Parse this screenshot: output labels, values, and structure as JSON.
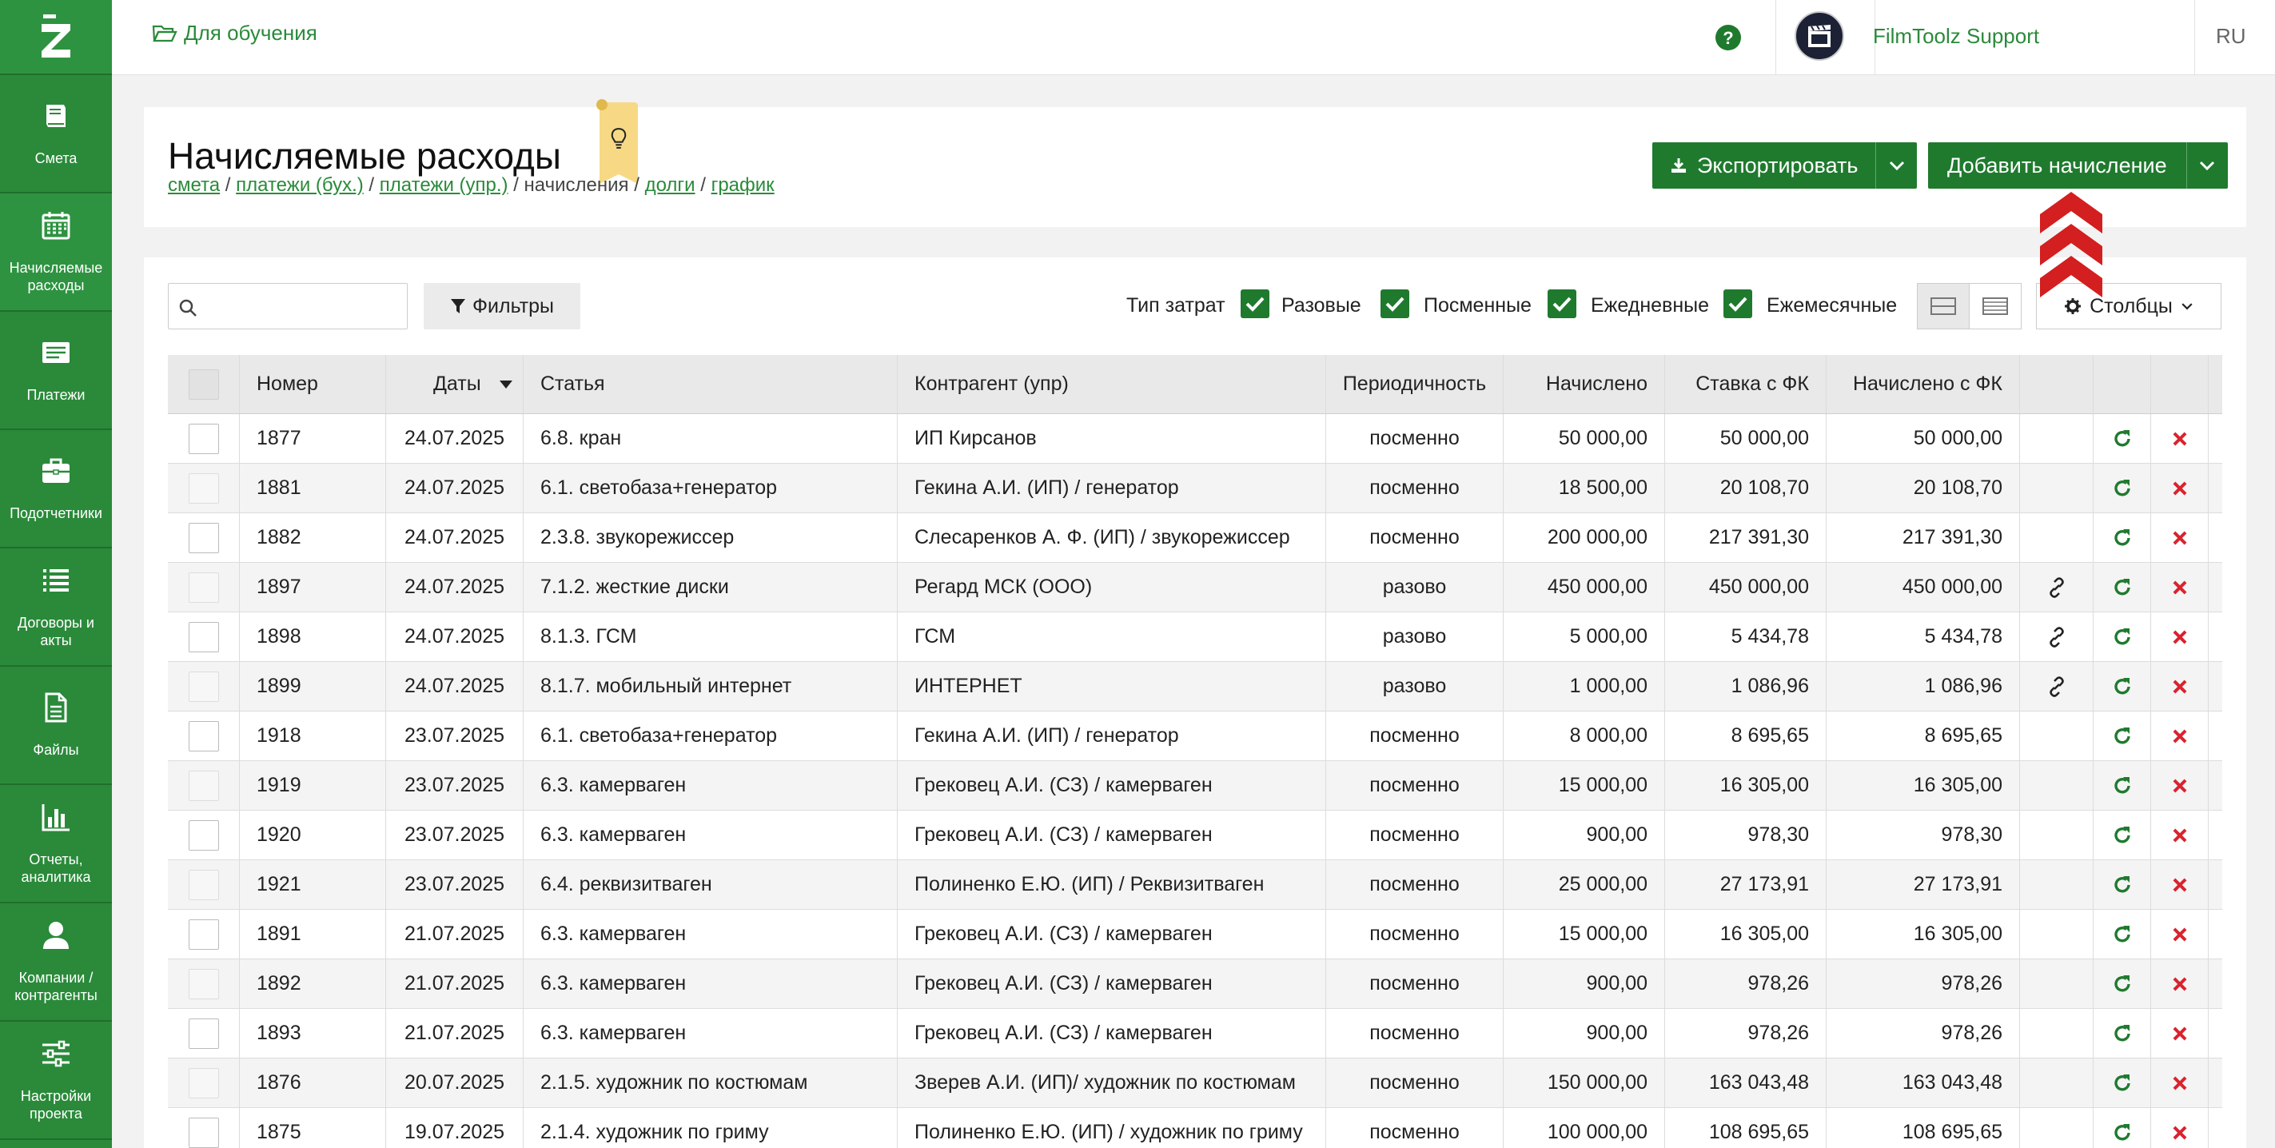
{
  "app": {
    "logo": "Z"
  },
  "sidebar": {
    "items": [
      {
        "label": "Смета",
        "icon": "book-icon"
      },
      {
        "label": "Начисляемые\nрасходы",
        "icon": "calendar-icon"
      },
      {
        "label": "Платежи",
        "icon": "list-card-icon"
      },
      {
        "label": "Подотчетники",
        "icon": "briefcase-icon"
      },
      {
        "label": "Договоры и\nакты",
        "icon": "list-icon"
      },
      {
        "label": "Файлы",
        "icon": "file-icon"
      },
      {
        "label": "Отчеты,\nаналитика",
        "icon": "bar-chart-icon"
      },
      {
        "label": "Компании /\nконтрагенты",
        "icon": "user-icon"
      },
      {
        "label": "Настройки\nпроекта",
        "icon": "sliders-icon"
      }
    ]
  },
  "topbar": {
    "project": "Для обучения",
    "user_name": "FilmToolz Support",
    "lang": "RU"
  },
  "header": {
    "title": "Начисляемые расходы",
    "breadcrumbs": [
      "смета",
      "платежи (бух.)",
      "платежи (упр.)",
      "начисления",
      "долги",
      "график"
    ],
    "export_label": "Экспортировать",
    "add_label": "Добавить начисление"
  },
  "toolbar": {
    "search_placeholder": "",
    "filters_label": "Фильтры",
    "cost_type_label": "Тип затрат",
    "cost_types": [
      "Разовые",
      "Посменные",
      "Ежедневные",
      "Ежемесячные"
    ],
    "columns_label": "Столбцы"
  },
  "table": {
    "headers": [
      "Номер",
      "Даты",
      "Статья",
      "Контрагент (упр)",
      "Периодичность",
      "Начислено",
      "Ставка с ФК",
      "Начислено с ФК"
    ],
    "rows": [
      {
        "num": "1877",
        "date": "24.07.2025",
        "item": "6.8. кран",
        "party": "ИП Кирсанов",
        "period": "посменно",
        "accrued": "50 000,00",
        "rate": "50 000,00",
        "total": "50 000,00",
        "link": false
      },
      {
        "num": "1881",
        "date": "24.07.2025",
        "item": "6.1. светобаза+генератор",
        "party": "Гекина А.И. (ИП) / генератор",
        "period": "посменно",
        "accrued": "18 500,00",
        "rate": "20 108,70",
        "total": "20 108,70",
        "link": false
      },
      {
        "num": "1882",
        "date": "24.07.2025",
        "item": "2.3.8. звукорежиссер",
        "party": "Слесаренков А. Ф. (ИП) / звукорежиссер",
        "period": "посменно",
        "accrued": "200 000,00",
        "rate": "217 391,30",
        "total": "217 391,30",
        "link": false
      },
      {
        "num": "1897",
        "date": "24.07.2025",
        "item": "7.1.2. жесткие диски",
        "party": "Регард МСК (ООО)",
        "period": "разово",
        "accrued": "450 000,00",
        "rate": "450 000,00",
        "total": "450 000,00",
        "link": true
      },
      {
        "num": "1898",
        "date": "24.07.2025",
        "item": "8.1.3. ГСМ",
        "party": "ГСМ",
        "period": "разово",
        "accrued": "5 000,00",
        "rate": "5 434,78",
        "total": "5 434,78",
        "link": true
      },
      {
        "num": "1899",
        "date": "24.07.2025",
        "item": "8.1.7. мобильный интернет",
        "party": "ИНТЕРНЕТ",
        "period": "разово",
        "accrued": "1 000,00",
        "rate": "1 086,96",
        "total": "1 086,96",
        "link": true
      },
      {
        "num": "1918",
        "date": "23.07.2025",
        "item": "6.1. светобаза+генератор",
        "party": "Гекина А.И. (ИП) / генератор",
        "period": "посменно",
        "accrued": "8 000,00",
        "rate": "8 695,65",
        "total": "8 695,65",
        "link": false
      },
      {
        "num": "1919",
        "date": "23.07.2025",
        "item": "6.3. камерваген",
        "party": "Грековец А.И. (СЗ) / камерваген",
        "period": "посменно",
        "accrued": "15 000,00",
        "rate": "16 305,00",
        "total": "16 305,00",
        "link": false
      },
      {
        "num": "1920",
        "date": "23.07.2025",
        "item": "6.3. камерваген",
        "party": "Грековец А.И. (СЗ) / камерваген",
        "period": "посменно",
        "accrued": "900,00",
        "rate": "978,30",
        "total": "978,30",
        "link": false
      },
      {
        "num": "1921",
        "date": "23.07.2025",
        "item": "6.4. реквизитваген",
        "party": "Полиненко Е.Ю. (ИП) / Реквизитваген",
        "period": "посменно",
        "accrued": "25 000,00",
        "rate": "27 173,91",
        "total": "27 173,91",
        "link": false
      },
      {
        "num": "1891",
        "date": "21.07.2025",
        "item": "6.3. камерваген",
        "party": "Грековец А.И. (СЗ) / камерваген",
        "period": "посменно",
        "accrued": "15 000,00",
        "rate": "16 305,00",
        "total": "16 305,00",
        "link": false
      },
      {
        "num": "1892",
        "date": "21.07.2025",
        "item": "6.3. камерваген",
        "party": "Грековец А.И. (СЗ) / камерваген",
        "period": "посменно",
        "accrued": "900,00",
        "rate": "978,26",
        "total": "978,26",
        "link": false
      },
      {
        "num": "1893",
        "date": "21.07.2025",
        "item": "6.3. камерваген",
        "party": "Грековец А.И. (СЗ) / камерваген",
        "period": "посменно",
        "accrued": "900,00",
        "rate": "978,26",
        "total": "978,26",
        "link": false
      },
      {
        "num": "1876",
        "date": "20.07.2025",
        "item": "2.1.5. художник по костюмам",
        "party": "Зверев А.И. (ИП)/ художник по костюмам",
        "period": "посменно",
        "accrued": "150 000,00",
        "rate": "163 043,48",
        "total": "163 043,48",
        "link": false
      },
      {
        "num": "1875",
        "date": "19.07.2025",
        "item": "2.1.4. художник по гриму",
        "party": "Полиненко Е.Ю. (ИП) / художник по гриму",
        "period": "посменно",
        "accrued": "100 000,00",
        "rate": "108 695,65",
        "total": "108 695,65",
        "link": false
      }
    ]
  },
  "colors": {
    "brand": "#2a8a3a",
    "button": "#1f7a2e",
    "delete": "#d9232e",
    "arrow": "#d31f1f"
  }
}
